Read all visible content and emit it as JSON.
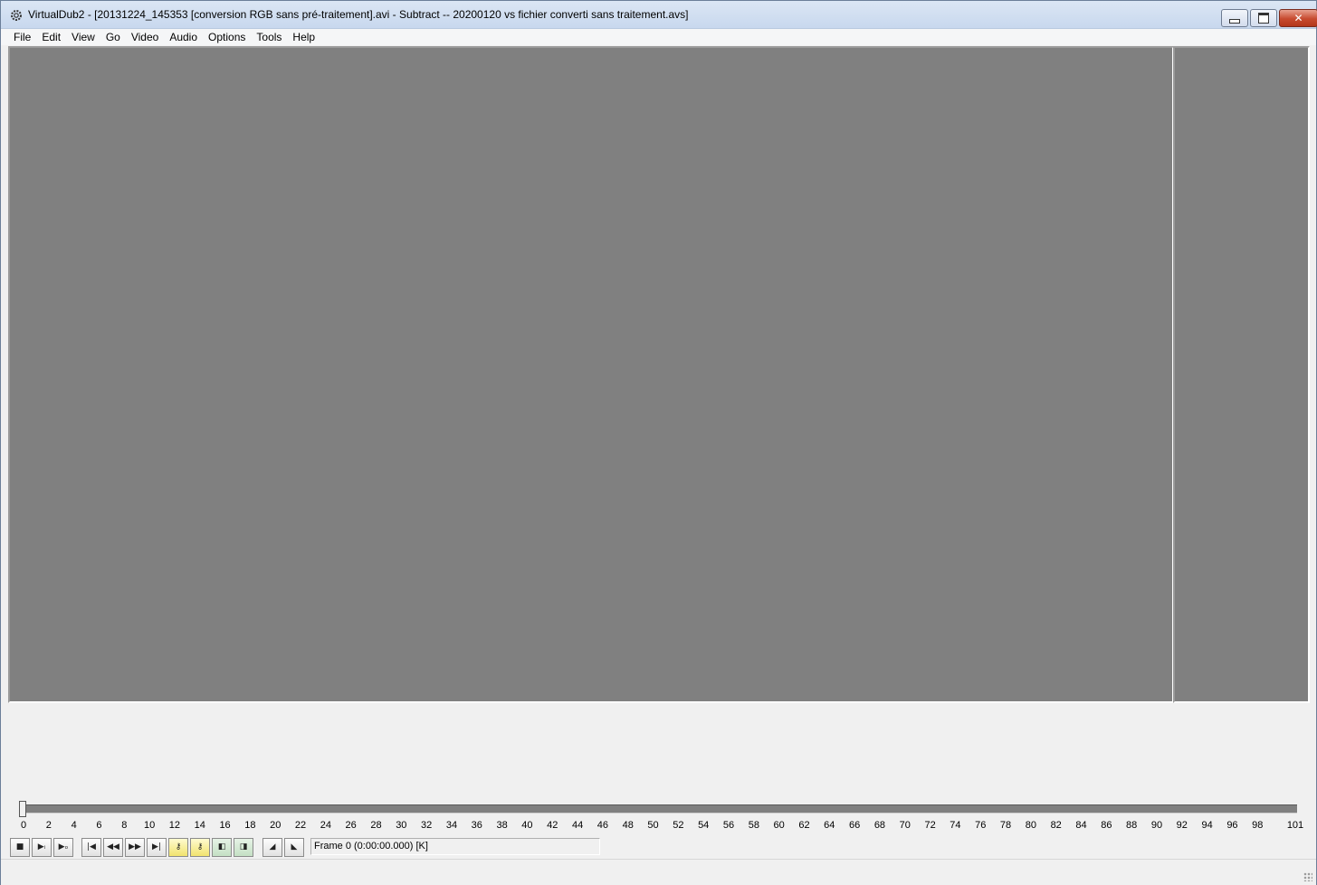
{
  "window": {
    "title": "VirtualDub2  - [20131224_145353 [conversion RGB sans pré-traitement].avi - Subtract -- 20200120 vs fichier converti sans traitement.avs]"
  },
  "menu": {
    "items": [
      "File",
      "Edit",
      "View",
      "Go",
      "Video",
      "Audio",
      "Options",
      "Tools",
      "Help"
    ]
  },
  "timeline": {
    "current_frame": 0,
    "total_frames": 101,
    "tick_labels": [
      "0",
      "2",
      "4",
      "6",
      "8",
      "10",
      "12",
      "14",
      "16",
      "18",
      "20",
      "22",
      "24",
      "26",
      "28",
      "30",
      "32",
      "34",
      "36",
      "38",
      "40",
      "42",
      "44",
      "46",
      "48",
      "50",
      "52",
      "54",
      "56",
      "58",
      "60",
      "62",
      "64",
      "66",
      "68",
      "70",
      "72",
      "74",
      "76",
      "78",
      "80",
      "82",
      "84",
      "86",
      "88",
      "90",
      "92",
      "94",
      "96",
      "98",
      "101"
    ]
  },
  "toolbar": {
    "buttons": [
      {
        "name": "stop-button",
        "icon": "stop-icon",
        "glyph": "■"
      },
      {
        "name": "play-input-button",
        "icon": "play-input-icon",
        "glyph": "▶ᵢ"
      },
      {
        "name": "play-output-button",
        "icon": "play-output-icon",
        "glyph": "▶ₒ"
      },
      {
        "name": "go-start-button",
        "icon": "go-start-icon",
        "glyph": "|◀"
      },
      {
        "name": "prev-frame-button",
        "icon": "prev-frame-icon",
        "glyph": "◀◀"
      },
      {
        "name": "next-frame-button",
        "icon": "next-frame-icon",
        "glyph": "▶▶"
      },
      {
        "name": "go-end-button",
        "icon": "go-end-icon",
        "glyph": "▶|"
      },
      {
        "name": "prev-keyframe-button",
        "icon": "prev-keyframe-icon",
        "glyph": "⚷"
      },
      {
        "name": "next-keyframe-button",
        "icon": "next-keyframe-icon",
        "glyph": "⚷"
      },
      {
        "name": "prev-scene-button",
        "icon": "prev-scene-icon",
        "glyph": "◧"
      },
      {
        "name": "next-scene-button",
        "icon": "next-scene-icon",
        "glyph": "◨"
      },
      {
        "name": "mark-in-button",
        "icon": "mark-in-icon",
        "glyph": "◢"
      },
      {
        "name": "mark-out-button",
        "icon": "mark-out-icon",
        "glyph": "◣"
      }
    ],
    "frame_status": "Frame 0 (0:00:00.000) [K]"
  },
  "colors": {
    "pane_background": "#808080",
    "window_background": "#f0f0f0",
    "close_button": "#c74a2e"
  }
}
